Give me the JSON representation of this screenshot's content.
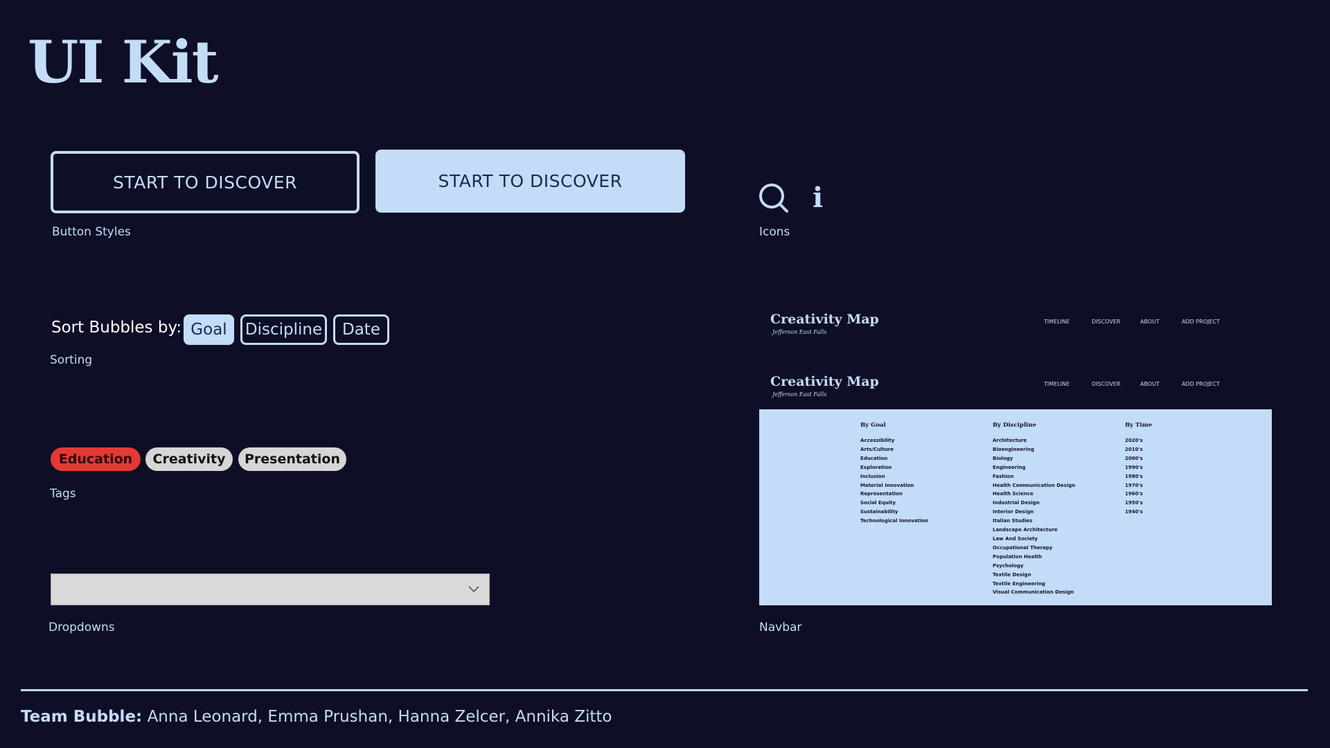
{
  "title": "UI Kit",
  "buttons": {
    "outline_label": "START TO DISCOVER",
    "filled_label": "START TO DISCOVER",
    "caption": "Button Styles"
  },
  "icons": {
    "caption": "Icons",
    "info_glyph": "i"
  },
  "sorting": {
    "label": "Sort Bubbles by:",
    "options": [
      "Goal",
      "Discipline",
      "Date"
    ],
    "caption": "Sorting"
  },
  "tags": {
    "items": [
      "Education",
      "Creativity",
      "Presentation"
    ],
    "caption": "Tags"
  },
  "dropdowns": {
    "caption": "Dropdowns"
  },
  "navbar": {
    "brand": "Creativity Map",
    "brand_sub": "Jefferson East Falls",
    "links": [
      "TIMELINE",
      "DISCOVER",
      "ABOUT",
      "ADD PROJECT"
    ],
    "caption": "Navbar",
    "menu": {
      "goal": {
        "heading": "By Goal",
        "items": [
          "Accessibility",
          "Arts/Culture",
          "Education",
          "Exploration",
          "Inclusion",
          "Material Innovation",
          "Representation",
          "Social Equity",
          "Sustainability",
          "Technological Innovation"
        ]
      },
      "discipline": {
        "heading": "By Discipline",
        "items": [
          "Architecture",
          "Bioengineering",
          "Biology",
          "Engineering",
          "Fashion",
          "Health Communication Design",
          "Health Science",
          "Industrial Design",
          "Interior Design",
          "Italian Studies",
          "Landscape Architecture",
          "Law And Society",
          "Occupational Therapy",
          "Population Health",
          "Psychology",
          "Textile Design",
          "Textile Engineering",
          "Visual Communication Design"
        ]
      },
      "time": {
        "heading": "By Time",
        "items": [
          "2020's",
          "2010's",
          "2000's",
          "1990's",
          "1980's",
          "1970's",
          "1960's",
          "1950's",
          "1940's"
        ]
      }
    }
  },
  "footer": {
    "team_label": "Team Bubble:",
    "members": "Anna Leonard, Emma Prushan, Hanna Zelcer, Annika Zitto"
  },
  "colors": {
    "background": "#0e0e26",
    "accent": "#c3dcf8",
    "tag_red": "#e53935",
    "tag_grey": "#d6d6d6"
  }
}
